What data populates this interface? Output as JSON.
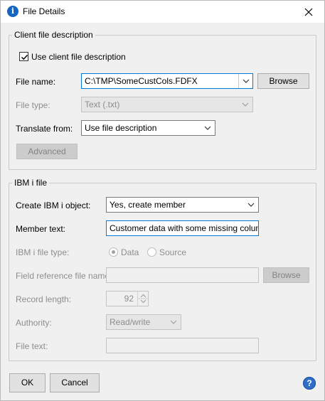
{
  "window": {
    "title": "File Details",
    "app_icon": "info-icon",
    "close_icon": "close-icon"
  },
  "client_group": {
    "legend": "Client file description",
    "use_client_desc": {
      "label": "Use client file description",
      "checked": true
    },
    "file_name": {
      "label": "File name:",
      "value": "C:\\TMP\\SomeCustCols.FDFX"
    },
    "browse_label": "Browse",
    "file_type": {
      "label": "File type:",
      "value": "Text (.txt)"
    },
    "translate_from": {
      "label": "Translate from:",
      "value": "Use file description"
    },
    "advanced_label": "Advanced"
  },
  "ibm_group": {
    "legend": "IBM i file",
    "create_object": {
      "label": "Create IBM i object:",
      "value": "Yes, create member"
    },
    "member_text": {
      "label": "Member text:",
      "value": "Customer data with some missing columns"
    },
    "file_type": {
      "label": "IBM i file type:",
      "options": [
        "Data",
        "Source"
      ],
      "selected": "Data"
    },
    "field_ref": {
      "label": "Field reference file name:",
      "value": ""
    },
    "browse_label": "Browse",
    "record_length": {
      "label": "Record length:",
      "value": "92"
    },
    "authority": {
      "label": "Authority:",
      "value": "Read/write"
    },
    "file_text": {
      "label": "File text:",
      "value": ""
    }
  },
  "footer": {
    "ok_label": "OK",
    "cancel_label": "Cancel",
    "help_icon": "help-icon",
    "help_glyph": "?"
  },
  "colors": {
    "focus_border": "#0078d7",
    "help_icon_bg": "#2f6fc8",
    "disabled_text": "#8d8d8d"
  }
}
